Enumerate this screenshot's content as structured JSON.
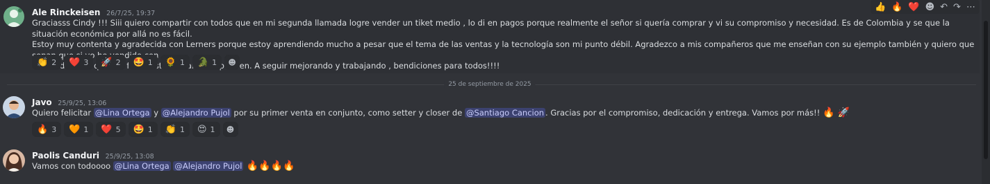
{
  "toolbar": {
    "items": [
      {
        "name": "thumbs-up-icon",
        "glyph": "👍"
      },
      {
        "name": "fire-icon",
        "glyph": "🔥"
      },
      {
        "name": "heart-icon",
        "glyph": "❤️"
      },
      {
        "name": "add-reaction-icon",
        "glyph": "☻"
      },
      {
        "name": "reply-icon",
        "glyph": "↶"
      },
      {
        "name": "forward-icon",
        "glyph": "↷"
      },
      {
        "name": "more-icon",
        "glyph": "⋯"
      }
    ]
  },
  "messages": [
    {
      "author": "Ale Rinckeisen",
      "timestamp": "26/7/25, 19:37",
      "lines": [
        "Graciasss Cindy !!! Siii quiero compartir con todos que en mi segunda llamada logre vender un tiket medio , lo di en pagos porque realmente el señor si quería comprar y vi su compromiso y necesidad. Es de Colombia y se que la situación económica por allá no es fácil.",
        "Estoy muy contenta y agradecida con Lerners porque estoy aprendiendo mucho a pesar que el tema de las ventas y la tecnología son mi punto débil.  Agradezco a mis compañeros que me enseñan con su ejemplo también y quiero que sepan que si yo he vendido con",
        "tantos detalles que me falta, ustedes también pueden. A seguir mejorando y trabajando , bendiciones para todos!!!!"
      ],
      "reactions": [
        {
          "emoji": "👏",
          "count": "2"
        },
        {
          "emoji": "❤️",
          "count": "3"
        },
        {
          "emoji": "🚀",
          "count": "2"
        },
        {
          "emoji": "🤩",
          "count": "1"
        },
        {
          "emoji": "🌻",
          "count": "1"
        },
        {
          "emoji": "🐊",
          "count": "1"
        }
      ]
    },
    {
      "author": "Javo",
      "timestamp": "25/9/25, 13:06",
      "segments": [
        {
          "t": "Quiero felicitar "
        },
        {
          "t": "@Lina Ortega",
          "mention": true
        },
        {
          "t": " y "
        },
        {
          "t": "@Alejandro Pujol",
          "mention": true
        },
        {
          "t": " por su primer venta en conjunto, como setter y closer de "
        },
        {
          "t": "@Santiago Cancion",
          "mention": true
        },
        {
          "t": ".  Gracias por el compromiso, dedicación y entrega. Vamos por más!! "
        },
        {
          "t": "🔥 🚀",
          "emoji": true
        }
      ],
      "reactions": [
        {
          "emoji": "🔥",
          "count": "3"
        },
        {
          "emoji": "🧡",
          "count": "1"
        },
        {
          "emoji": "❤️",
          "count": "5"
        },
        {
          "emoji": "🤩",
          "count": "1"
        },
        {
          "emoji": "👏",
          "count": "1"
        },
        {
          "emoji": "😍",
          "count": "1"
        }
      ]
    },
    {
      "author": "Paolis Canduri",
      "timestamp": "25/9/25, 13:08",
      "segments": [
        {
          "t": "Vamos con todoooo "
        },
        {
          "t": "@Lina Ortega",
          "mention": true
        },
        {
          "t": " "
        },
        {
          "t": "@Alejandro Pujol",
          "mention": true
        },
        {
          "t": " 🔥🔥🔥🔥",
          "emoji": true
        }
      ]
    }
  ],
  "date_divider": "25 de septiembre de 2025",
  "add_reaction_glyph": "☻"
}
